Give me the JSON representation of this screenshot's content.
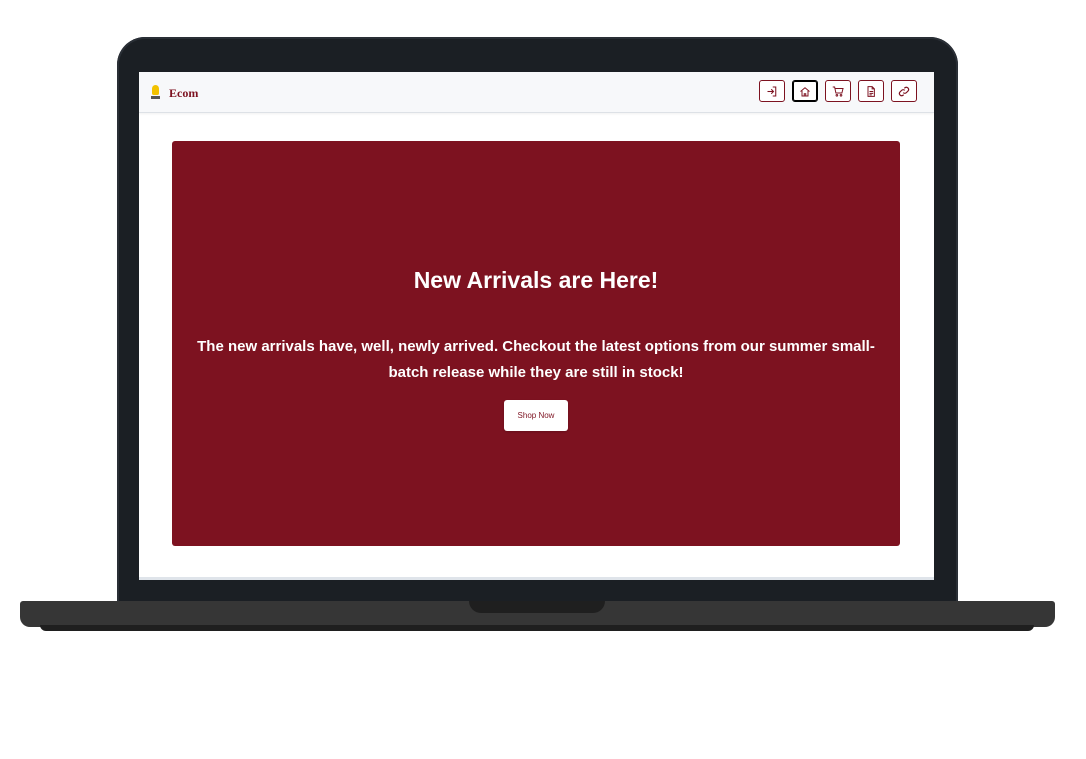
{
  "brand": {
    "name": "Ecom",
    "logo_icon": "lightbulb-icon"
  },
  "nav": {
    "buttons": [
      {
        "name": "login",
        "icon": "login-icon",
        "active": false
      },
      {
        "name": "home",
        "icon": "home-icon",
        "active": true
      },
      {
        "name": "cart",
        "icon": "cart-icon",
        "active": false
      },
      {
        "name": "document",
        "icon": "document-icon",
        "active": false
      },
      {
        "name": "link",
        "icon": "link-icon",
        "active": false
      }
    ]
  },
  "hero": {
    "title": "New Arrivals are Here!",
    "text": "The new arrivals have, well, newly arrived. Checkout the latest options from our summer small-batch release while they are still in stock!",
    "button_label": "Shop Now"
  },
  "colors": {
    "accent": "#7d1220",
    "bezel": "#1b1f24",
    "navbar_bg": "#f7f8fa"
  }
}
